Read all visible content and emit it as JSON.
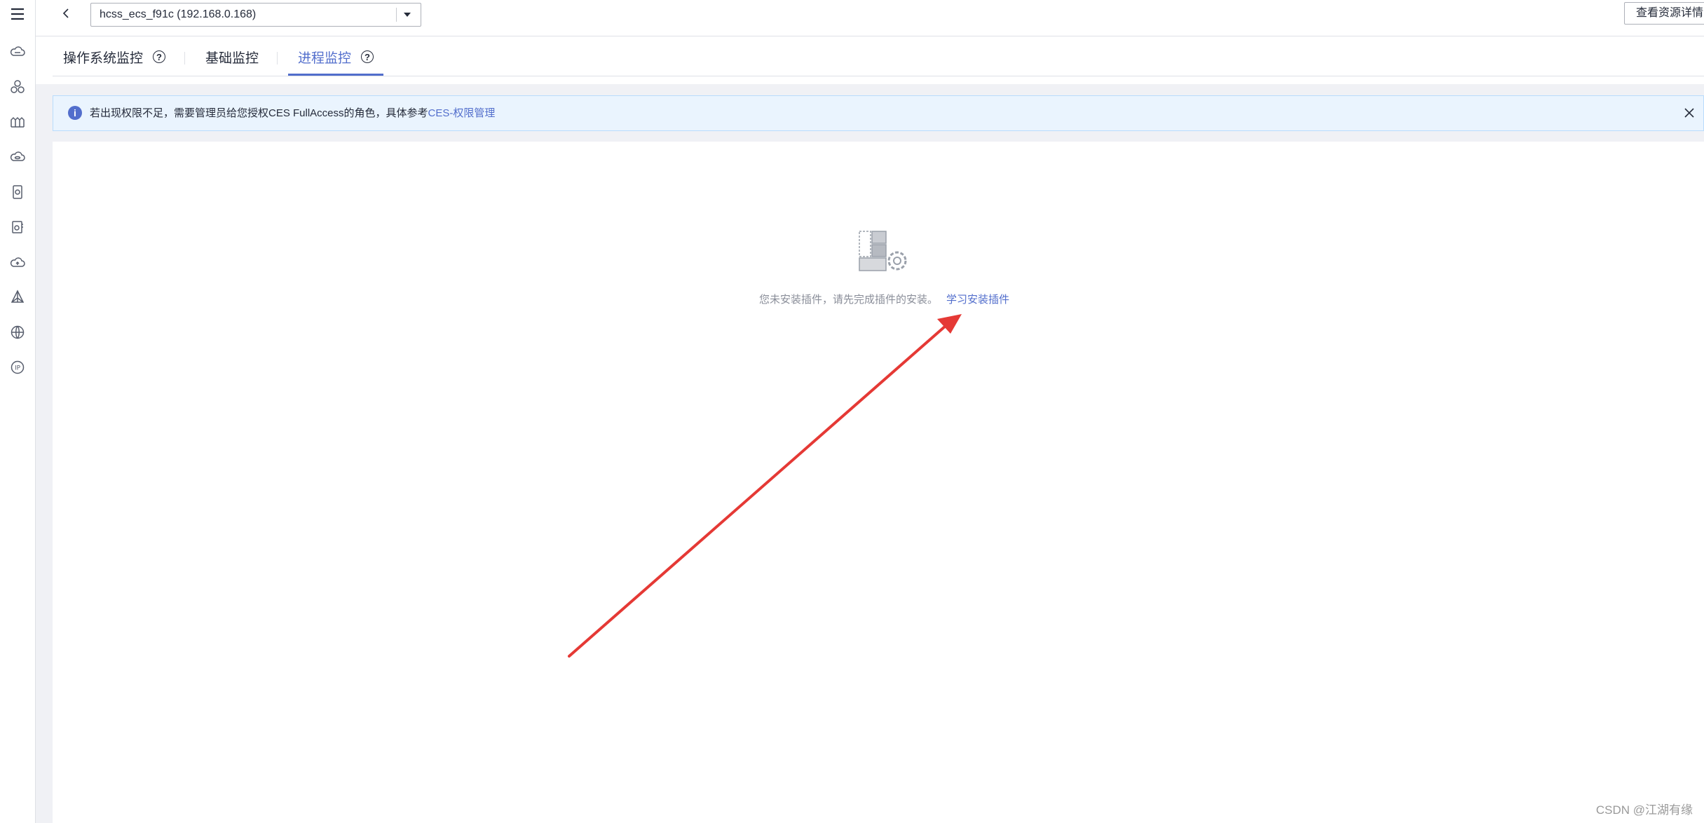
{
  "header": {
    "instance_value": "hcss_ecs_f91c (192.168.0.168)",
    "detail_button": "查看资源详情"
  },
  "tabs": [
    {
      "label": "操作系统监控",
      "has_help": true,
      "active": false
    },
    {
      "label": "基础监控",
      "has_help": false,
      "active": false
    },
    {
      "label": "进程监控",
      "has_help": true,
      "active": true
    }
  ],
  "notice": {
    "text": "若出现权限不足，需要管理员给您授权CES FullAccess的角色，具体参考",
    "link": "CES-权限管理"
  },
  "empty_state": {
    "text": "您未安装插件，请先完成插件的安装。",
    "link": "学习安装插件"
  },
  "sidebar": {
    "icons": [
      "menu-icon",
      "cloud-server-icon",
      "cluster-icon",
      "container-icon",
      "cloud-database-icon",
      "storage-icon",
      "backup-icon",
      "cloud-sync-icon",
      "network-icon",
      "globe-icon",
      "ip-icon"
    ]
  },
  "colors": {
    "accent": "#526ecc",
    "annotation_arrow": "#e53935",
    "notice_bg": "#eaf4fe"
  },
  "watermark": "CSDN @江湖有缘"
}
